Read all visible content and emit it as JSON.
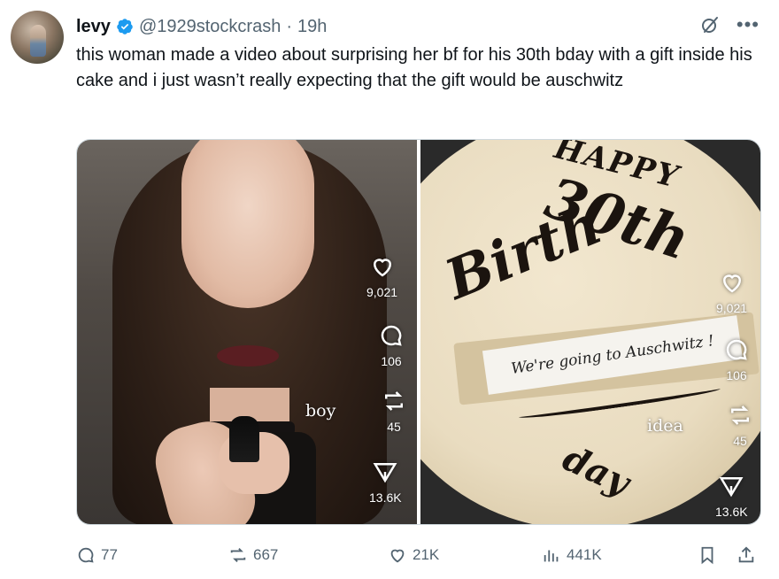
{
  "author": {
    "name": "levy",
    "handle": "@1929stockcrash",
    "separator": "·",
    "time": "19h",
    "verified_color": "#1d9bf0"
  },
  "tweet": {
    "text": "this woman made a video about surprising her bf for his 30th bday with a gift inside his cake and i just wasn’t really expecting that the gift would be auschwitz"
  },
  "media": {
    "left": {
      "likes": "9,021",
      "comments": "106",
      "reposts": "45",
      "shares": "13.6K",
      "caption": "boy"
    },
    "right": {
      "likes": "9,021",
      "comments": "106",
      "reposts": "45",
      "shares": "13.6K",
      "caption": "idea",
      "cake_happy": "HAPPY",
      "cake_30th": "30th",
      "cake_birth": "Birth",
      "cake_bottom": "day",
      "note": "We're going to Auschwitz !"
    }
  },
  "actions": {
    "replies": "77",
    "reposts": "667",
    "likes": "21K",
    "views": "441K"
  },
  "icons": [
    "verified-badge-icon",
    "grok-icon",
    "more-icon",
    "heart-icon",
    "comment-icon",
    "repost-icon",
    "send-icon",
    "reply-icon",
    "views-icon",
    "bookmark-icon",
    "share-icon"
  ]
}
